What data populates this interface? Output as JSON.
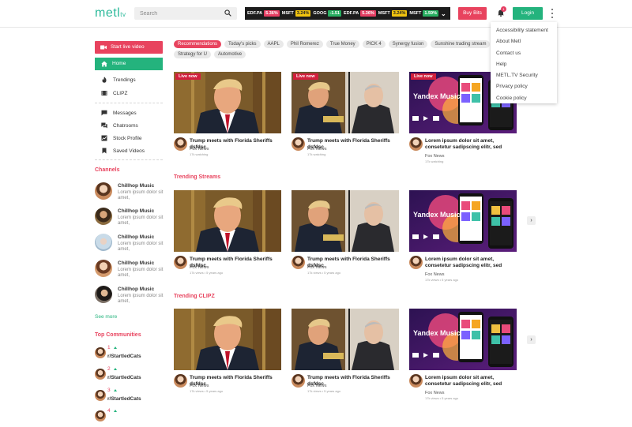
{
  "header": {
    "logo_text": "metl",
    "logo_suffix": "tv",
    "search_placeholder": "Search",
    "tickers": [
      {
        "symbol": "EDF.PA",
        "change": "5.36%",
        "tone": "red"
      },
      {
        "symbol": "MSFT",
        "change": "3.24%",
        "tone": "yel"
      },
      {
        "symbol": "GOOG",
        "change": "-1.51",
        "tone": "grn"
      },
      {
        "symbol": "EDF.PA",
        "change": "5.36%",
        "tone": "red"
      },
      {
        "symbol": "MSFT",
        "change": "3.24%",
        "tone": "yel"
      },
      {
        "symbol": "MSFT",
        "change": "1.59%",
        "tone": "grn"
      }
    ],
    "buy_bits_label": "Buy Bits",
    "notification_count": "1",
    "login_label": "Login"
  },
  "dropdown_menu": [
    "Accessibility statement",
    "About Metl",
    "Contact us",
    "Help",
    "METL.TV Security",
    "Privacy policy",
    "Cookie policy"
  ],
  "sidebar": {
    "live_label": "Start live video",
    "home_label": "Home",
    "nav_items": [
      "Trendings",
      "CLIPZ"
    ],
    "nav_items2": [
      "Messages",
      "Chatrooms",
      "Stock Profile",
      "Saved Videos"
    ],
    "channels_heading": "Channels",
    "channels": [
      {
        "name": "Chillhop Music",
        "desc": "Lorem ipsum dolor sit amet,"
      },
      {
        "name": "Chillhop Music",
        "desc": "Lorem ipsum dolor sit amet,"
      },
      {
        "name": "Chillhop Music",
        "desc": "Lorem ipsum dolor sit amet,"
      },
      {
        "name": "Chillhop Music",
        "desc": "Lorem ipsum dolor sit amet,"
      },
      {
        "name": "Chillhop Music",
        "desc": "Lorem ipsum dolor sit amet,"
      }
    ],
    "see_more_label": "See more",
    "communities_heading": "Top Communities",
    "communities": [
      {
        "rank": "1",
        "name": "r/StartledCats"
      },
      {
        "rank": "2",
        "name": "r/StartledCats"
      },
      {
        "rank": "3",
        "name": "r/StartledCats"
      },
      {
        "rank": "4",
        "name": ""
      }
    ]
  },
  "filters": [
    "Recommendations",
    "Today's picks",
    "AAPL",
    "Phil Romerez",
    "True Money",
    "PICK 4",
    "Synergy fusion",
    "Sunshine trading stream",
    "Strategy for U",
    "Automotive"
  ],
  "live_badge": "Live now",
  "sections": [
    {
      "title": "",
      "cards": [
        {
          "title": "Trump meets with Florida Sheriffs dsfdsc",
          "source": "Fox News",
          "meta": "17k watching"
        },
        {
          "title": "Trump meets with Florida Sheriffs dsfdsc",
          "source": "Fox News",
          "meta": "17k watching"
        },
        {
          "title": "Lorem ipsum dolor sit amet, consetetur sadipscing elitr, sed",
          "source": "Fox News",
          "meta": "17k watching"
        }
      ]
    },
    {
      "title": "Trending Streams",
      "cards": [
        {
          "title": "Trump meets with Florida Sheriffs dsfdsc",
          "source": "Fox News",
          "meta": "17k views • 5 years ago"
        },
        {
          "title": "Trump meets with Florida Sheriffs dsfdsc",
          "source": "Fox News",
          "meta": "17k views • 5 years ago"
        },
        {
          "title": "Lorem ipsum dolor sit amet, consetetur sadipscing elitr, sed",
          "source": "Fox News",
          "meta": "17k views • 5 years ago"
        }
      ]
    },
    {
      "title": "Trending CLIPZ",
      "cards": [
        {
          "title": "Trump meets with Florida Sheriffs dsfdsc",
          "source": "Fox News",
          "meta": "17k views • 5 years ago"
        },
        {
          "title": "Trump meets with Florida Sheriffs dsfdsc",
          "source": "Fox News",
          "meta": "17k views • 5 years ago"
        },
        {
          "title": "Lorem ipsum dolor sit amet, consetetur sadipscing elitr, sed",
          "source": "Fox News",
          "meta": "17k views • 5 years ago"
        }
      ]
    }
  ],
  "yandex_music_text": "Yandex Music",
  "colors": {
    "brand_green": "#24b37d",
    "brand_pink": "#e8435e",
    "live_red": "#d21f3c"
  }
}
